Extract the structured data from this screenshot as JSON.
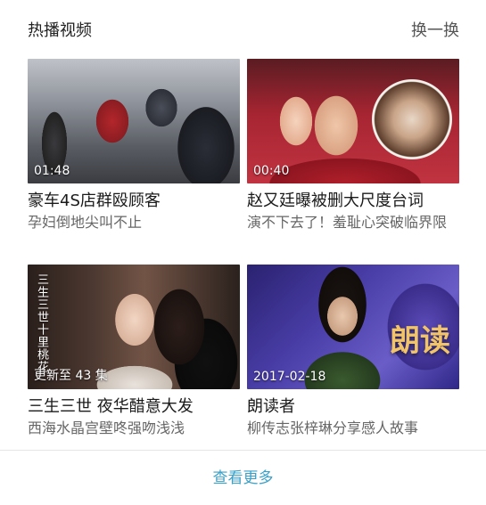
{
  "header": {
    "title": "热播视频",
    "refresh_label": "换一换"
  },
  "cards": [
    {
      "overlay": "01:48",
      "headline": "豪车4S店群殴顾客",
      "subtitle": "孕妇倒地尖叫不止"
    },
    {
      "overlay": "00:40",
      "headline": "赵又廷曝被删大尺度台词",
      "subtitle": "演不下去了！羞耻心突破临界限"
    },
    {
      "overlay": "更新至 43 集",
      "headline": "三生三世 夜华醋意大发",
      "subtitle": "西海水晶宫壁咚强吻浅浅",
      "thumb_text": "三生三世十里桃花"
    },
    {
      "overlay": "2017-02-18",
      "headline": "朗读者",
      "subtitle": "柳传志张梓琳分享感人故事",
      "thumb_text": "朗读"
    }
  ],
  "footer": {
    "more_label": "查看更多"
  },
  "colors": {
    "link": "#3aa0c8",
    "subtitle": "#666666"
  }
}
